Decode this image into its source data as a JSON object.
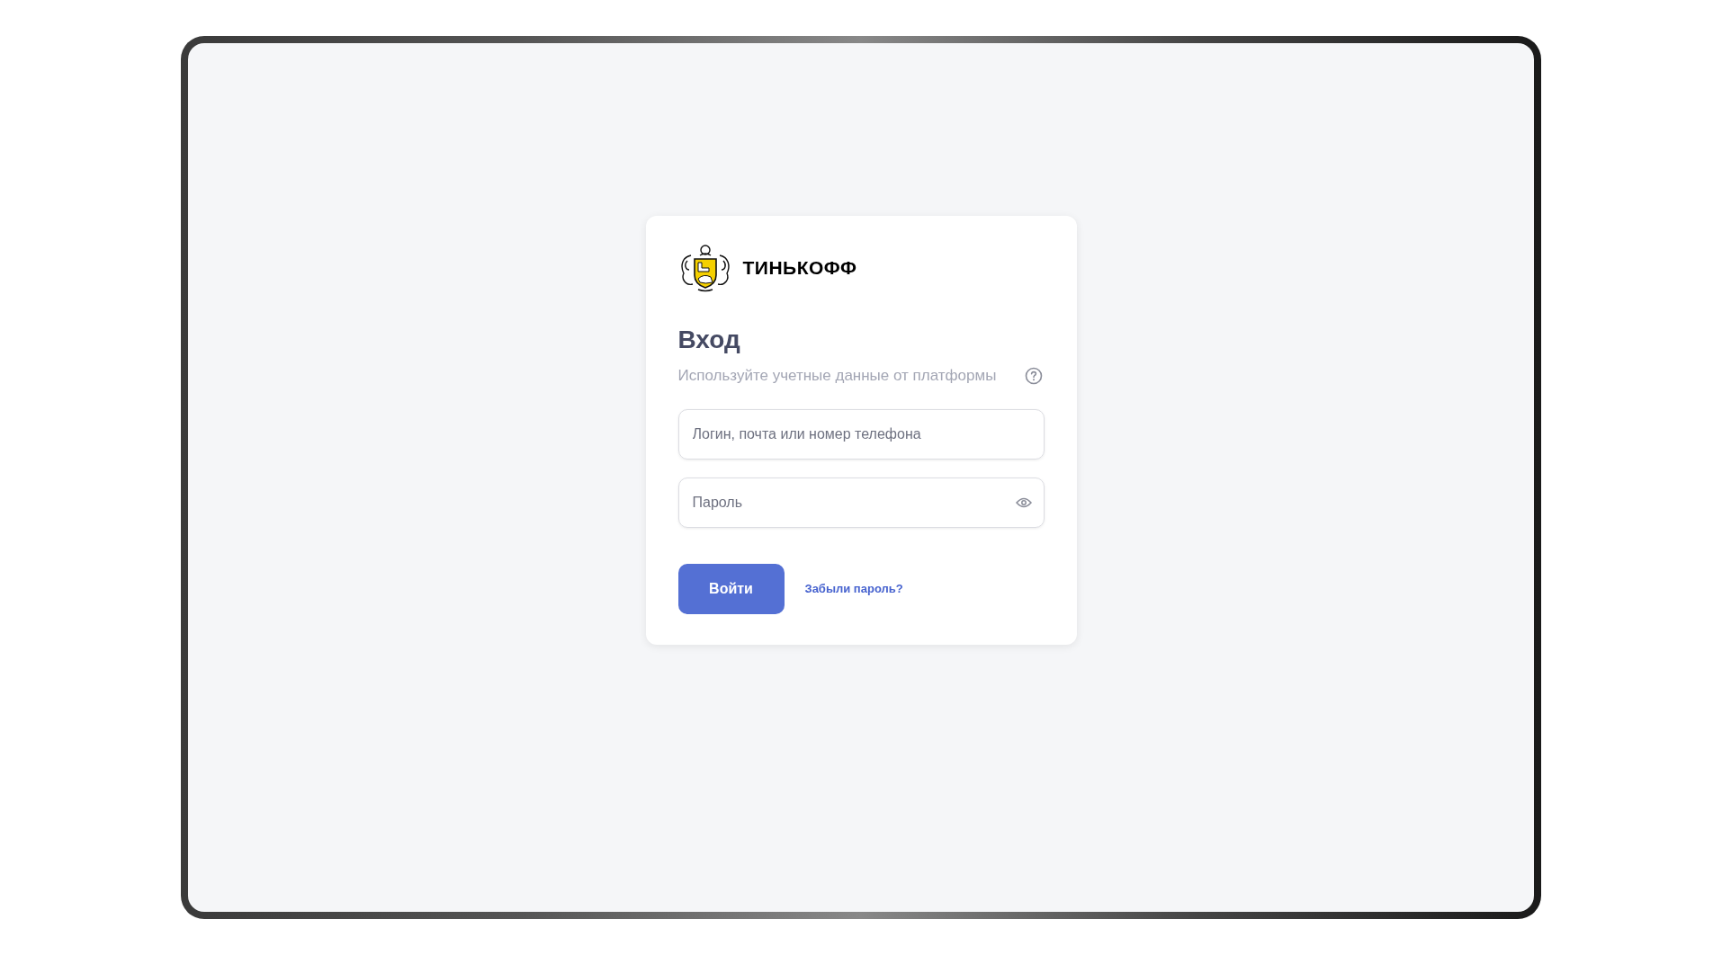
{
  "logo": {
    "wordmark": "ТИНЬКОФФ"
  },
  "title": "Вход",
  "subtitle": "Используйте учетные данные от платформы",
  "login_field": {
    "placeholder": "Логин, почта или номер телефона"
  },
  "password_field": {
    "placeholder": "Пароль"
  },
  "submit_button": "Войти",
  "forgot_link": "Забыли пароль?"
}
